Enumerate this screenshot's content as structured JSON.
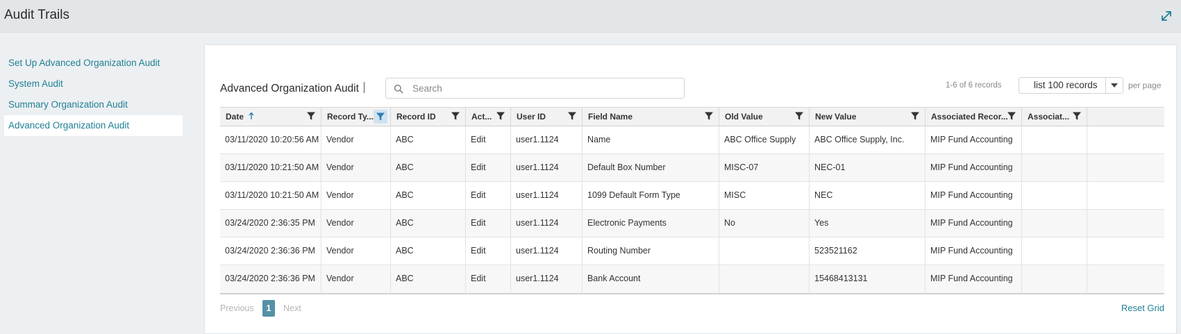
{
  "header": {
    "title": "Audit Trails",
    "expand_icon": "expand-arrows-icon"
  },
  "sidebar": {
    "items": [
      {
        "label": "Set Up Advanced Organization Audit",
        "active": false
      },
      {
        "label": "System Audit",
        "active": false
      },
      {
        "label": "Summary Organization Audit",
        "active": false
      },
      {
        "label": "Advanced Organization Audit",
        "active": true
      }
    ]
  },
  "main": {
    "section_title": "Advanced Organization Audit",
    "search": {
      "placeholder": "Search",
      "value": ""
    },
    "records_count": "1-6 of 6 records",
    "page_size": {
      "selected": "list 100 records"
    },
    "per_page_label": "per page",
    "grid": {
      "columns": [
        {
          "label": "Date",
          "sorted": "ascending",
          "filter_active": false
        },
        {
          "label": "Record Ty...",
          "filter_active": true
        },
        {
          "label": "Record ID",
          "filter_active": false
        },
        {
          "label": "Act...",
          "filter_active": false
        },
        {
          "label": "User ID",
          "filter_active": false
        },
        {
          "label": "Field Name",
          "filter_active": false
        },
        {
          "label": "Old Value",
          "filter_active": false
        },
        {
          "label": "New Value",
          "filter_active": false
        },
        {
          "label": "Associated Recor...",
          "filter_active": false
        },
        {
          "label": "Associat...",
          "filter_active": false
        }
      ],
      "rows": [
        [
          "03/11/2020 10:20:56 AM",
          "Vendor",
          "ABC",
          "Edit",
          "user1.1124",
          "Name",
          "ABC Office Supply",
          "ABC Office Supply, Inc.",
          "MIP Fund Accounting",
          ""
        ],
        [
          "03/11/2020 10:21:50 AM",
          "Vendor",
          "ABC",
          "Edit",
          "user1.1124",
          "Default Box Number",
          "MISC-07",
          "NEC-01",
          "MIP Fund Accounting",
          ""
        ],
        [
          "03/11/2020 10:21:50 AM",
          "Vendor",
          "ABC",
          "Edit",
          "user1.1124",
          "1099 Default Form Type",
          "MISC",
          "NEC",
          "MIP Fund Accounting",
          ""
        ],
        [
          "03/24/2020 2:36:35 PM",
          "Vendor",
          "ABC",
          "Edit",
          "user1.1124",
          "Electronic Payments",
          "No",
          "Yes",
          "MIP Fund Accounting",
          ""
        ],
        [
          "03/24/2020 2:36:36 PM",
          "Vendor",
          "ABC",
          "Edit",
          "user1.1124",
          "Routing Number",
          "",
          "523521162",
          "MIP Fund Accounting",
          ""
        ],
        [
          "03/24/2020 2:36:36 PM",
          "Vendor",
          "ABC",
          "Edit",
          "user1.1124",
          "Bank Account",
          "",
          "15468413131",
          "MIP Fund Accounting",
          ""
        ]
      ]
    },
    "pager": {
      "previous_label": "Previous",
      "current_page": "1",
      "next_label": "Next",
      "reset_label": "Reset Grid"
    },
    "colors": {
      "accent": "#1f7f95",
      "active_page": "#5591a6",
      "active_filter_bg": "#cfe3f1"
    }
  }
}
